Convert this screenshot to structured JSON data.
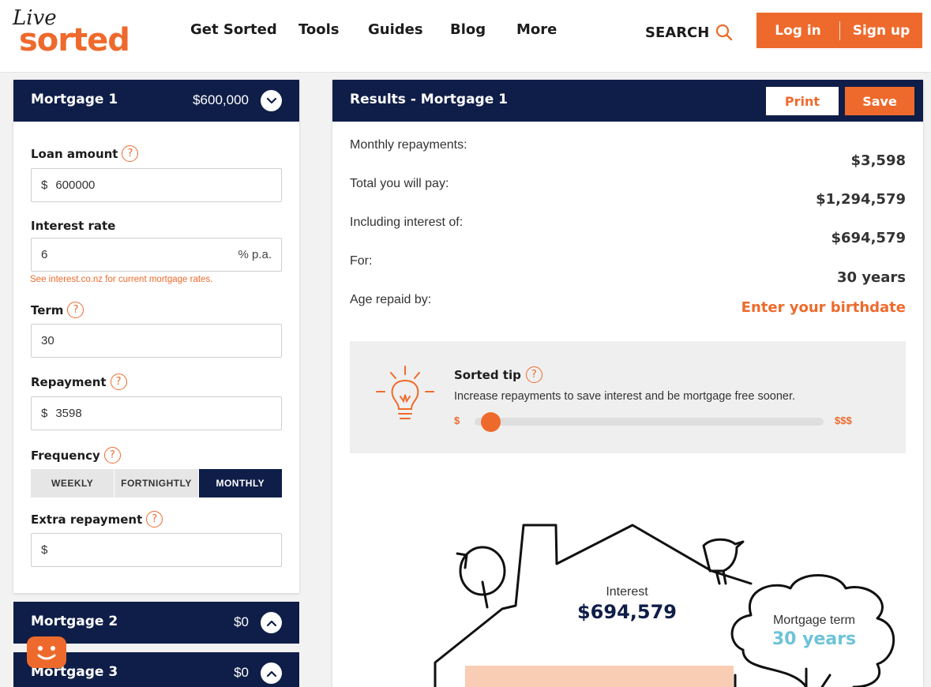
{
  "brand": {
    "script": "Live",
    "name": "sorted"
  },
  "nav": {
    "items": [
      "Get Sorted",
      "Tools",
      "Guides",
      "Blog",
      "More"
    ],
    "search": "SEARCH",
    "login": "Log in",
    "signup": "Sign up"
  },
  "mortgages": [
    {
      "title": "Mortgage 1",
      "amount": "$600,000"
    },
    {
      "title": "Mortgage 2",
      "amount": "$0"
    },
    {
      "title": "Mortgage 3",
      "amount": "$0"
    }
  ],
  "form": {
    "loan_label": "Loan amount",
    "loan_prefix": "$",
    "loan_value": "600000",
    "rate_label": "Interest rate",
    "rate_value": "6",
    "rate_suffix": "% p.a.",
    "rate_hint": "See interest.co.nz for current mortgage rates.",
    "term_label": "Term",
    "term_value": "30",
    "repay_label": "Repayment",
    "repay_prefix": "$",
    "repay_value": "3598",
    "freq_label": "Frequency",
    "freq_options": [
      "WEEKLY",
      "FORTNIGHTLY",
      "MONTHLY"
    ],
    "freq_selected": "MONTHLY",
    "extra_label": "Extra repayment",
    "extra_prefix": "$",
    "help": "?"
  },
  "results": {
    "title": "Results - Mortgage 1",
    "print": "Print",
    "save": "Save",
    "rows": [
      {
        "label": "Monthly repayments:",
        "value": "$3,598"
      },
      {
        "label": "Total you will pay:",
        "value": "$1,294,579"
      },
      {
        "label": "Including interest of:",
        "value": "$694,579"
      },
      {
        "label": "For:",
        "value": "30 years"
      },
      {
        "label": "Age repaid by:",
        "value": "Enter your birthdate"
      }
    ]
  },
  "tip": {
    "title": "Sorted tip",
    "text": "Increase repayments to save interest and be mortgage free sooner.",
    "low": "$",
    "high": "$$$",
    "slider_value": 0.02
  },
  "illustration": {
    "interest_label": "Interest",
    "interest_value": "$694,579",
    "term_label": "Mortgage term",
    "term_value": "30 years"
  },
  "colors": {
    "navy": "#0f1e48",
    "orange": "#ee6a2c",
    "teal": "#6ec3d8"
  }
}
